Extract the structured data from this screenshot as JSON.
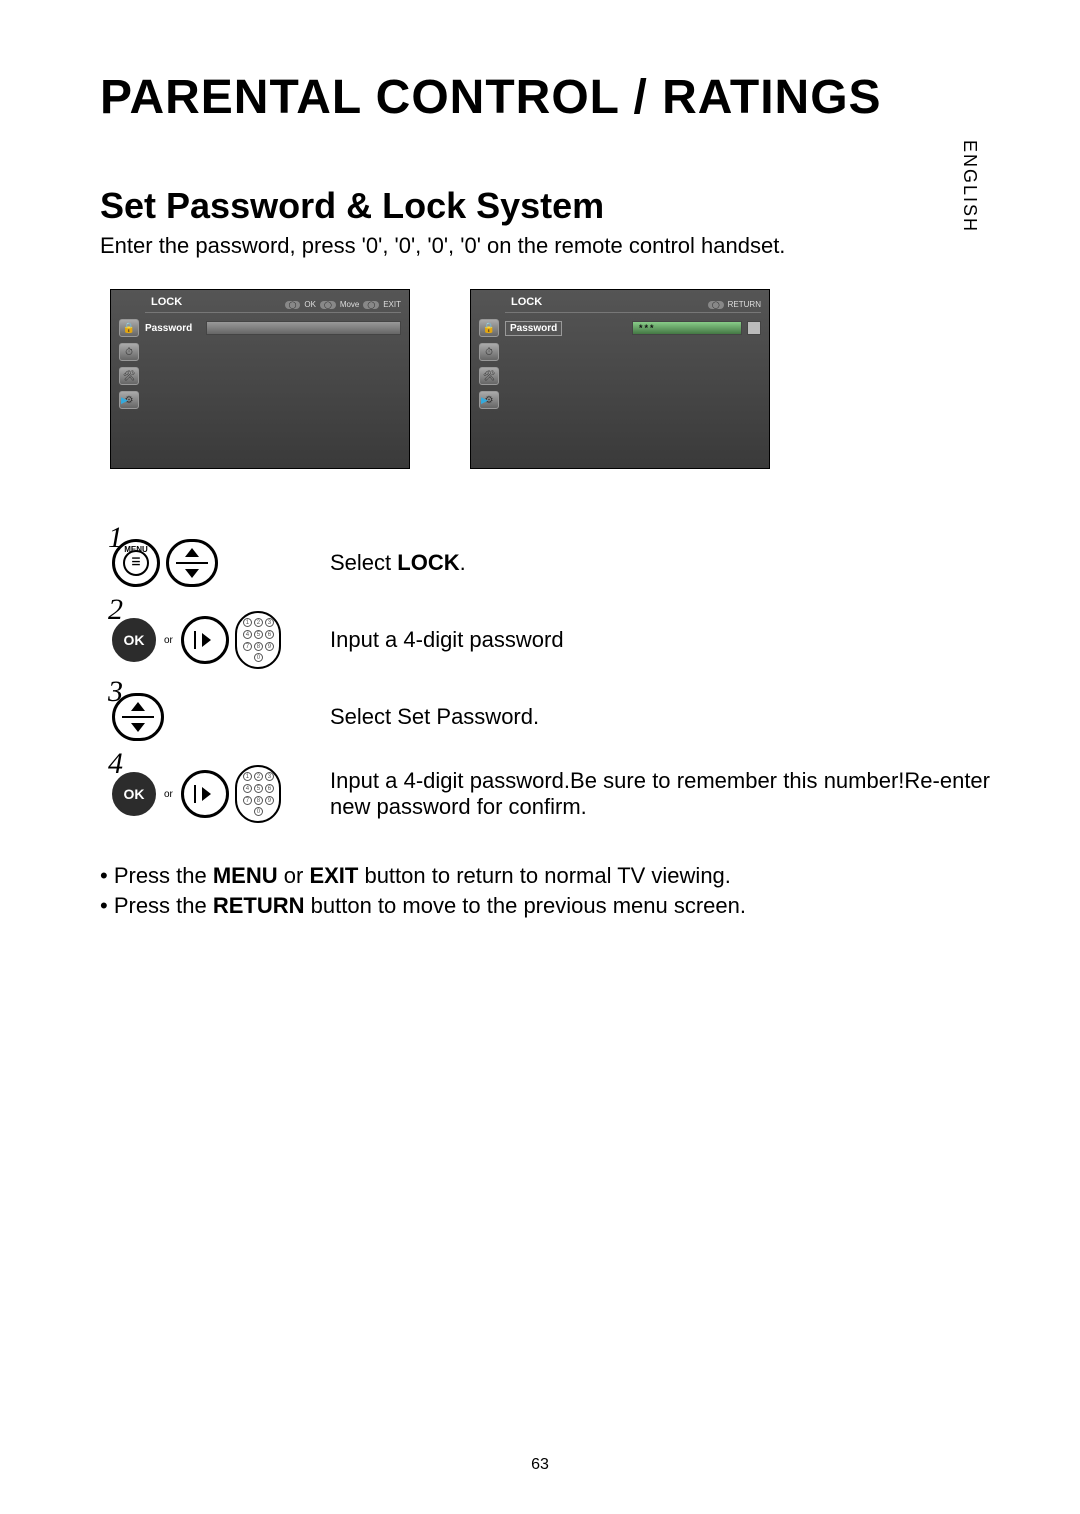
{
  "language_side": "ENGLISH",
  "main_title": "PARENTAL CONTROL / RATINGS",
  "sub_title": "Set Password & Lock System",
  "intro": "Enter the password, press '0', '0', '0', '0' on the remote control handset.",
  "screen_left": {
    "title": "LOCK",
    "hints": {
      "ok": "OK",
      "move": "Move",
      "exit": "EXIT"
    },
    "row_label": "Password"
  },
  "screen_right": {
    "title": "LOCK",
    "hints": {
      "return": "RETURN"
    },
    "row_label": "Password",
    "input_value": "***"
  },
  "steps": {
    "s1": {
      "num": "1",
      "menu_label": "MENU",
      "text_pre": "Select ",
      "text_bold": "LOCK",
      "text_post": "."
    },
    "s2": {
      "num": "2",
      "ok_label": "OK",
      "or": "or",
      "text": "Input a 4-digit password"
    },
    "s3": {
      "num": "3",
      "text": "Select Set Password."
    },
    "s4": {
      "num": "4",
      "ok_label": "OK",
      "or": "or",
      "text": "Input a 4-digit password.Be sure to remember this number!Re-enter new password for confirm."
    }
  },
  "notes": {
    "n1_pre": "• Press the ",
    "n1_b1": "MENU",
    "n1_mid": " or ",
    "n1_b2": "EXIT",
    "n1_post": " button to return to normal TV viewing.",
    "n2_pre": "• Press the ",
    "n2_b1": "RETURN",
    "n2_post": " button to move to the previous menu screen."
  },
  "page_number": "63"
}
